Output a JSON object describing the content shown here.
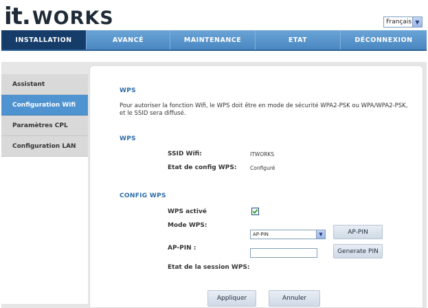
{
  "brand": {
    "logo_text": "it.WORKS"
  },
  "language": {
    "selected": "Français"
  },
  "topnav": {
    "tabs": [
      {
        "label": "INSTALLATION",
        "active": true
      },
      {
        "label": "AVANCÉ",
        "active": false
      },
      {
        "label": "MAINTENANCE",
        "active": false
      },
      {
        "label": "ETAT",
        "active": false
      },
      {
        "label": "DÉCONNEXION",
        "active": false
      }
    ]
  },
  "sidebar": {
    "items": [
      {
        "label": "Assistant",
        "active": false
      },
      {
        "label": "Configuration Wifi",
        "active": true
      },
      {
        "label": "Paramètres CPL",
        "active": false
      },
      {
        "label": "Configuration LAN",
        "active": false
      }
    ]
  },
  "main": {
    "section1_title": "WPS",
    "description": "Pour autoriser la fonction Wifi, le WPS doit être en mode de sécurité WPA2-PSK ou WPA/WPA2-PSK, et le SSID sera diffusé.",
    "section2_title": "WPS",
    "ssid_label": "SSID Wifi:",
    "ssid_value": "ITWORKS",
    "config_state_label": "Etat de config WPS:",
    "config_state_value": "Configuré",
    "section3_title": "CONFIG WPS",
    "wps_enabled_label": "WPS activé",
    "wps_enabled": true,
    "mode_label": "Mode WPS:",
    "mode_value": "AP-PIN",
    "ap_pin_button": "AP-PIN",
    "ap_pin_label": "AP-PIN :",
    "ap_pin_value": "",
    "generate_pin_button": "Generate PIN",
    "session_label": "Etat de la session WPS:",
    "apply_button": "Appliquer",
    "cancel_button": "Annuler"
  },
  "colors": {
    "nav": "#4a88c2",
    "nav_active": "#163d6a",
    "sidebar_active": "#4f93d1",
    "section_title": "#2b6ba6"
  }
}
